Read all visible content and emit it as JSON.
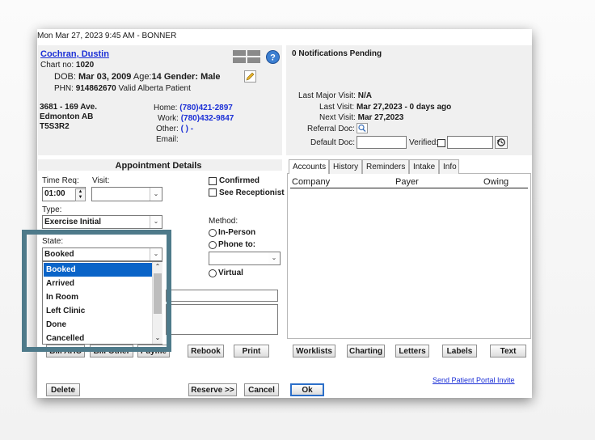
{
  "header": {
    "datetime": "Mon Mar 27, 2023  9:45 AM - BONNER"
  },
  "patient": {
    "name": "Cochran, Dustin",
    "chart_label": "Chart no:",
    "chart_no": "1020",
    "dob_label": "DOB:",
    "dob": "Mar 03, 2009",
    "age_label": "Age:",
    "age": "14",
    "gender_label": "Gender:",
    "gender": "Male",
    "phn_label": "PHN:",
    "phn": "914862670",
    "phn_status": "Valid Alberta Patient",
    "address1": "3681 - 169 Ave.",
    "address2": "Edmonton  AB",
    "postal": "T5S3R2",
    "home_label": "Home:",
    "home": "(780)421-2897",
    "work_label": "Work:",
    "work": "(780)432-9847",
    "other_label": "Other:",
    "other": "(  )  -",
    "email_label": "Email:"
  },
  "notifications": {
    "text": "0 Notifications Pending"
  },
  "visits": {
    "last_major_label": "Last Major Visit:",
    "last_major": "N/A",
    "last_label": "Last Visit:",
    "last": "Mar 27,2023 - 0 days ago",
    "next_label": "Next Visit:",
    "next": "Mar 27,2023",
    "referral_label": "Referral Doc:",
    "default_label": "Default Doc:",
    "verified_label": "Verified:"
  },
  "appointment": {
    "title": "Appointment Details",
    "time_req_label": "Time Req:",
    "time_req": "01:00",
    "visit_label": "Visit:",
    "confirmed_label": "Confirmed",
    "see_receptionist_label": "See Receptionist",
    "type_label": "Type:",
    "type_value": "Exercise Initial",
    "method_label": "Method:",
    "in_person_label": "In-Person",
    "phone_label": "Phone to:",
    "virtual_label": "Virtual",
    "state_label": "State:",
    "state_value": "Booked",
    "state_options": [
      "Booked",
      "Arrived",
      "In Room",
      "Left Clinic",
      "Done",
      "Cancelled"
    ]
  },
  "tabs": [
    "Accounts",
    "History",
    "Reminders",
    "Intake",
    "Info"
  ],
  "accounts_table": {
    "columns": [
      "Company",
      "Payer",
      "Owing"
    ]
  },
  "buttons": {
    "bill_ahc": "Bill AHC",
    "bill_other": "Bill Other",
    "pay": "Payme",
    "rebook": "Rebook",
    "print": "Print",
    "worklists": "Worklists",
    "charting": "Charting",
    "letters": "Letters",
    "labels": "Labels",
    "text": "Text",
    "delete": "Delete",
    "reserve": "Reserve >>",
    "cancel": "Cancel",
    "ok": "Ok"
  },
  "portal_link": "Send Patient Portal Invite",
  "colors": {
    "accent_link": "#1b2fd6",
    "selection": "#0a64c8",
    "highlight_frame": "#4e7a8a"
  }
}
